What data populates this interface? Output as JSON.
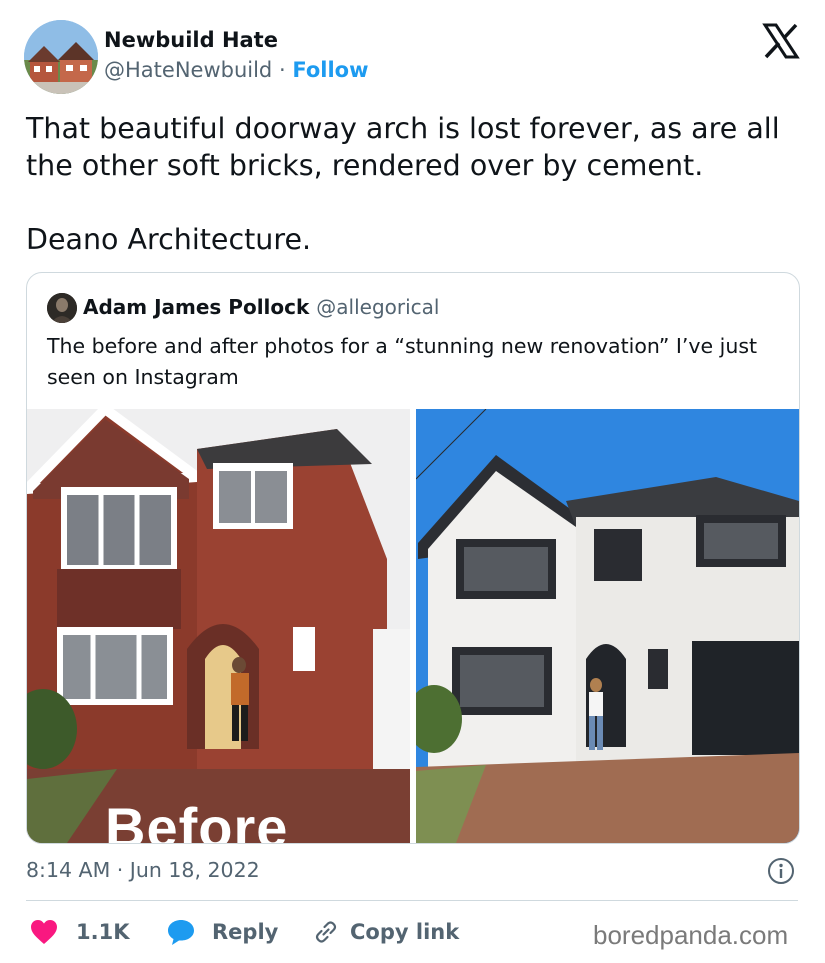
{
  "author": {
    "name": "Newbuild Hate",
    "handle": "@HateNewbuild",
    "separator": "·",
    "follow_label": "Follow"
  },
  "tweet": {
    "line1": "That beautiful doorway arch is lost forever, as are all the other soft bricks, rendered over by cement.",
    "line2": "Deano Architecture."
  },
  "quote": {
    "name": "Adam James Pollock",
    "handle": "@allegorical",
    "text": "The before and after photos for a “stunning new renovation” I’ve just seen on Instagram",
    "before_label": "Before"
  },
  "footer": {
    "timestamp": "8:14 AM · Jun 18, 2022",
    "likes": "1.1K",
    "reply_label": "Reply",
    "copy_label": "Copy link"
  },
  "watermark": "boredpanda.com",
  "colors": {
    "accent": "#1d9bf0",
    "like": "#f91880",
    "text": "#0f1419",
    "muted": "#536471"
  }
}
